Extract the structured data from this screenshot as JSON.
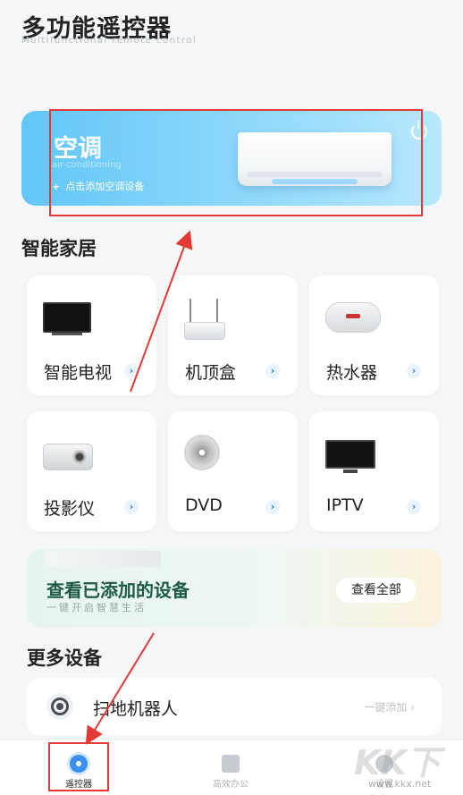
{
  "header": {
    "title": "多功能遥控器",
    "subtitle": "Multifunctional remote control"
  },
  "ac_card": {
    "title": "空调",
    "subtitle": "air-conditioning",
    "add_plus": "+",
    "add_label": "点击添加空调设备",
    "icon": "power-icon"
  },
  "smart_home": {
    "title": "智能家居",
    "devices": [
      {
        "label": "智能电视",
        "icon": "tv-icon"
      },
      {
        "label": "机顶盒",
        "icon": "set-top-box-icon"
      },
      {
        "label": "热水器",
        "icon": "water-heater-icon"
      },
      {
        "label": "投影仪",
        "icon": "projector-icon"
      },
      {
        "label": "DVD",
        "icon": "dvd-icon"
      },
      {
        "label": "IPTV",
        "icon": "iptv-icon"
      }
    ],
    "arrow_glyph": "›"
  },
  "added_banner": {
    "title": "查看已添加的设备",
    "subtitle": "一键开启智慧生活",
    "button": "查看全部"
  },
  "more_devices": {
    "title": "更多设备",
    "items": [
      {
        "label": "扫地机器人",
        "action": "一键添加 ›",
        "icon": "robot-vacuum-icon"
      }
    ]
  },
  "tabbar": {
    "tabs": [
      {
        "label": "遥控器",
        "icon": "remote-icon",
        "active": true
      },
      {
        "label": "高效办公",
        "icon": "folder-icon",
        "active": false
      },
      {
        "label": "设置",
        "icon": "settings-icon",
        "active": false
      }
    ]
  },
  "watermark": {
    "text": "KK下载",
    "url": "www.kkx.net"
  },
  "colors": {
    "accent": "#3b8ff0",
    "annotation_red": "#e53935",
    "ac_gradient_start": "#62c6f7"
  }
}
